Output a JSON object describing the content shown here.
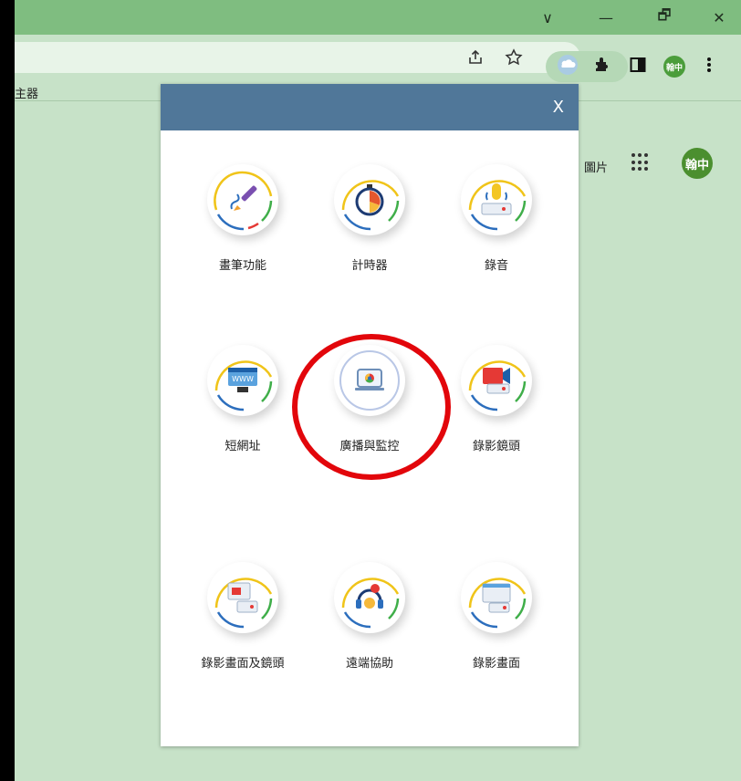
{
  "window": {
    "controls": [
      "∨",
      "—",
      "🗗",
      "✕"
    ]
  },
  "toolbar": {
    "share_icon": "share-icon",
    "star_icon": "star-icon",
    "extension_icon": "puzzle-icon",
    "sidepanel_icon": "sidepanel-icon",
    "profile_label": "翰中",
    "menu_icon": "more-vert-icon"
  },
  "bookmarks": {
    "text": "主器"
  },
  "page": {
    "link_text": "圖片",
    "avatar_label": "翰中"
  },
  "panel": {
    "close_label": "X",
    "tools": [
      {
        "label": "畫筆功能",
        "icon": "pen-icon"
      },
      {
        "label": "計時器",
        "icon": "stopwatch-icon"
      },
      {
        "label": "錄音",
        "icon": "microphone-icon"
      },
      {
        "label": "短網址",
        "icon": "www-icon"
      },
      {
        "label": "廣播與監控",
        "icon": "chrome-laptop-icon"
      },
      {
        "label": "錄影鏡頭",
        "icon": "video-camera-icon"
      },
      {
        "label": "錄影畫面及鏡頭",
        "icon": "screen-camera-icon"
      },
      {
        "label": "遠端協助",
        "icon": "headset-icon"
      },
      {
        "label": "錄影畫面",
        "icon": "screen-record-icon"
      }
    ]
  },
  "colors": {
    "chrome_green": "#7fbd80",
    "page_green": "#c7e2c8",
    "panel_header": "#507799",
    "highlight": "#e2060b"
  }
}
